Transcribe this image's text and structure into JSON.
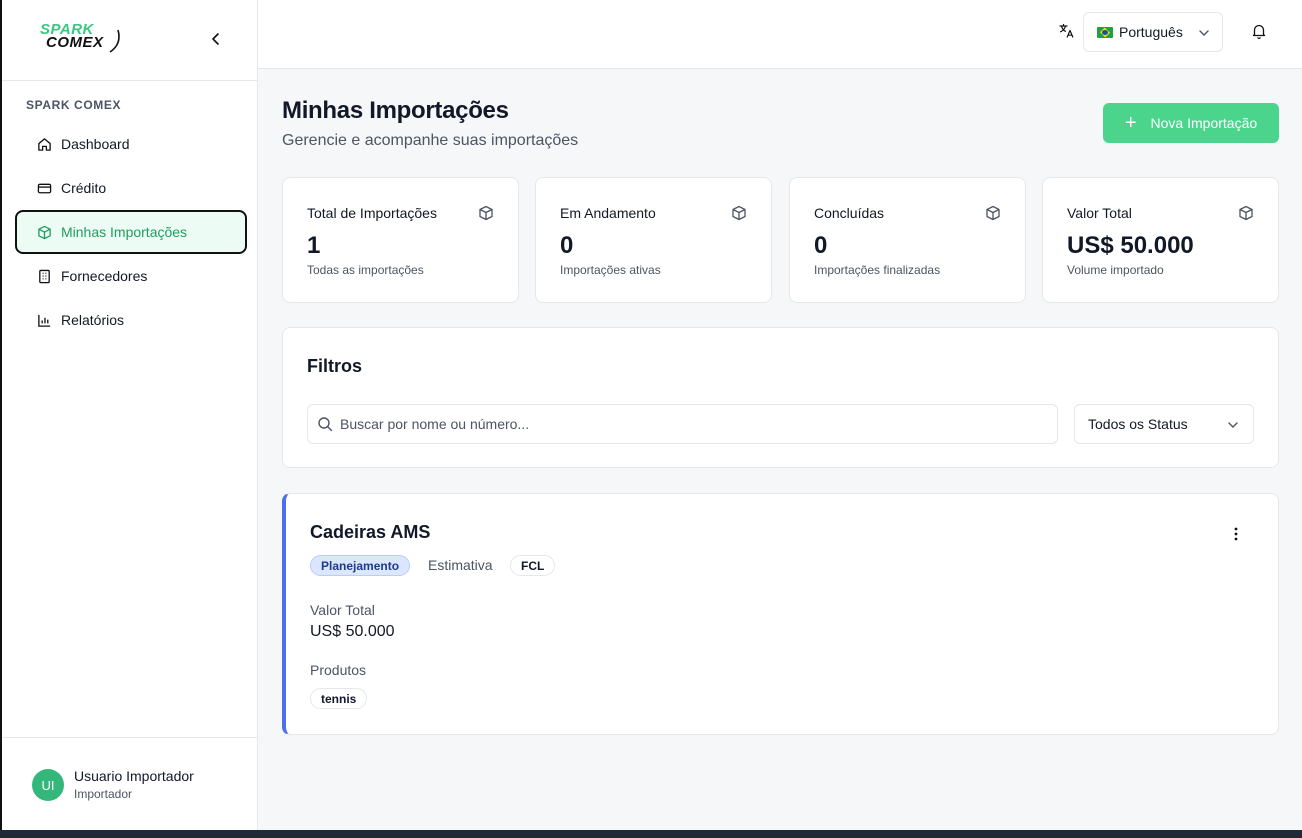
{
  "sidebar": {
    "logo_top": "SPARK",
    "logo_bottom": "COMEX",
    "section": "SPARK COMEX",
    "items": [
      {
        "label": "Dashboard",
        "icon": "home-icon"
      },
      {
        "label": "Crédito",
        "icon": "credit-card-icon"
      },
      {
        "label": "Minhas Importações",
        "icon": "package-icon",
        "active": true
      },
      {
        "label": "Fornecedores",
        "icon": "building-icon"
      },
      {
        "label": "Relatórios",
        "icon": "bar-chart-icon"
      }
    ],
    "user": {
      "initials": "UI",
      "name": "Usuario Importador",
      "role": "Importador"
    }
  },
  "topbar": {
    "language": "Português"
  },
  "page": {
    "title": "Minhas Importações",
    "subtitle": "Gerencie e acompanhe suas importações",
    "new_button": "Nova Importação"
  },
  "stats": [
    {
      "label": "Total de Importações",
      "value": "1",
      "desc": "Todas as importações"
    },
    {
      "label": "Em Andamento",
      "value": "0",
      "desc": "Importações ativas"
    },
    {
      "label": "Concluídas",
      "value": "0",
      "desc": "Importações finalizadas"
    },
    {
      "label": "Valor Total",
      "value": "US$ 50.000",
      "desc": "Volume importado"
    }
  ],
  "filters": {
    "title": "Filtros",
    "search_placeholder": "Buscar por nome ou número...",
    "status_selected": "Todos os Status"
  },
  "import_card": {
    "title": "Cadeiras AMS",
    "status_badge": "Planejamento",
    "estimate": "Estimativa",
    "mode_badge": "FCL",
    "value_label": "Valor Total",
    "value": "US$ 50.000",
    "products_label": "Produtos",
    "products": [
      "tennis"
    ]
  },
  "colors": {
    "accent": "#4ad48c",
    "active_nav": "#1f9e5f",
    "card_border": "#4f6ff0"
  }
}
